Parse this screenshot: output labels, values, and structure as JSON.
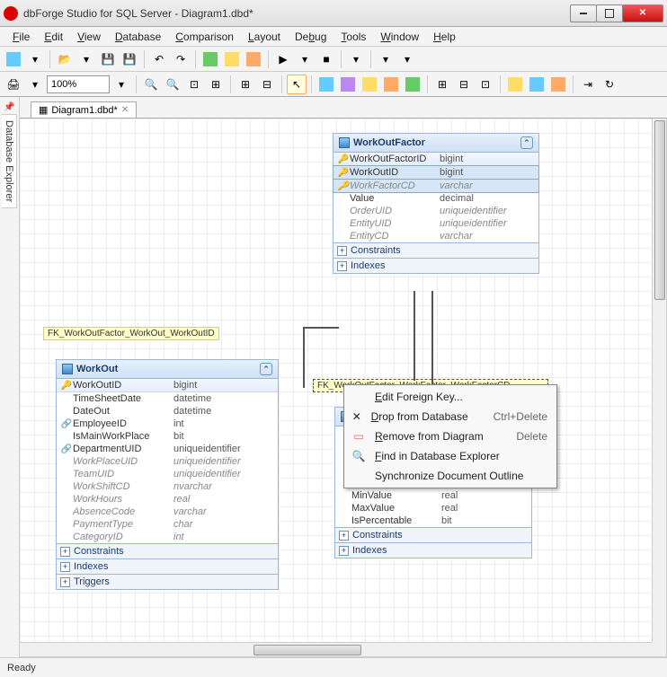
{
  "window": {
    "title": "dbForge Studio for SQL Server - Diagram1.dbd*"
  },
  "menu": {
    "items": [
      "File",
      "Edit",
      "View",
      "Database",
      "Comparison",
      "Layout",
      "Debug",
      "Tools",
      "Window",
      "Help"
    ]
  },
  "toolbar2": {
    "zoom": "100%"
  },
  "sidebar": {
    "tab": "Database Explorer"
  },
  "doc": {
    "tab": "Diagram1.dbd*"
  },
  "fk1": {
    "label": "FK_WorkOutFactor_WorkOut_WorkOutID"
  },
  "fk2": {
    "label": "FK_WorkOutFactor_WorkFactor_WorkFactorCD"
  },
  "entities": {
    "workoutfactor": {
      "title": "WorkOutFactor",
      "cols": [
        {
          "icon": "key",
          "name": "WorkOutFactorID",
          "type": "bigint",
          "ital": false,
          "sel": false,
          "hdr": true
        },
        {
          "icon": "key",
          "name": "WorkOutID",
          "type": "bigint",
          "ital": false,
          "sel": true,
          "hdr": false
        },
        {
          "icon": "key",
          "name": "WorkFactorCD",
          "type": "varchar",
          "ital": true,
          "sel": true,
          "hdr": false
        },
        {
          "icon": "",
          "name": "Value",
          "type": "decimal",
          "ital": false,
          "sel": false,
          "hdr": false
        },
        {
          "icon": "",
          "name": "OrderUID",
          "type": "uniqueidentifier",
          "ital": true,
          "sel": false,
          "hdr": false
        },
        {
          "icon": "",
          "name": "EntityUID",
          "type": "uniqueidentifier",
          "ital": true,
          "sel": false,
          "hdr": false
        },
        {
          "icon": "",
          "name": "EntityCD",
          "type": "varchar",
          "ital": true,
          "sel": false,
          "hdr": false
        }
      ],
      "sections": [
        "Constraints",
        "Indexes"
      ]
    },
    "workout": {
      "title": "WorkOut",
      "cols": [
        {
          "icon": "key",
          "name": "WorkOutID",
          "type": "bigint",
          "ital": false,
          "hdr": true
        },
        {
          "icon": "",
          "name": "TimeSheetDate",
          "type": "datetime",
          "ital": false
        },
        {
          "icon": "",
          "name": "DateOut",
          "type": "datetime",
          "ital": false
        },
        {
          "icon": "link",
          "name": "EmployeeID",
          "type": "int",
          "ital": false
        },
        {
          "icon": "",
          "name": "IsMainWorkPlace",
          "type": "bit",
          "ital": false
        },
        {
          "icon": "link",
          "name": "DepartmentUID",
          "type": "uniqueidentifier",
          "ital": false
        },
        {
          "icon": "",
          "name": "WorkPlaceUID",
          "type": "uniqueidentifier",
          "ital": true
        },
        {
          "icon": "",
          "name": "TeamUID",
          "type": "uniqueidentifier",
          "ital": true
        },
        {
          "icon": "",
          "name": "WorkShiftCD",
          "type": "nvarchar",
          "ital": true
        },
        {
          "icon": "",
          "name": "WorkHours",
          "type": "real",
          "ital": true
        },
        {
          "icon": "",
          "name": "AbsenceCode",
          "type": "varchar",
          "ital": true
        },
        {
          "icon": "",
          "name": "PaymentType",
          "type": "char",
          "ital": true
        },
        {
          "icon": "",
          "name": "CategoryID",
          "type": "int",
          "ital": true
        }
      ],
      "sections": [
        "Constraints",
        "Indexes",
        "Triggers"
      ]
    },
    "workfactor": {
      "partial_cols": [
        {
          "name": "MinValue",
          "type": "real"
        },
        {
          "name": "MaxValue",
          "type": "real"
        },
        {
          "name": "IsPercentable",
          "type": "bit"
        }
      ],
      "sections": [
        "Constraints",
        "Indexes"
      ]
    }
  },
  "ctx": {
    "items": [
      {
        "icon": "",
        "label": "Edit Foreign Key...",
        "shortcut": "",
        "u": "E"
      },
      {
        "icon": "✕",
        "label": "Drop from Database",
        "shortcut": "Ctrl+Delete",
        "u": "D"
      },
      {
        "icon": "▭",
        "label": "Remove from Diagram",
        "shortcut": "Delete",
        "u": "R"
      },
      {
        "icon": "🔍",
        "label": "Find in Database Explorer",
        "shortcut": "",
        "u": "F"
      },
      {
        "icon": "",
        "label": "Synchronize Document Outline",
        "shortcut": "",
        "u": ""
      }
    ]
  },
  "status": {
    "text": "Ready"
  }
}
